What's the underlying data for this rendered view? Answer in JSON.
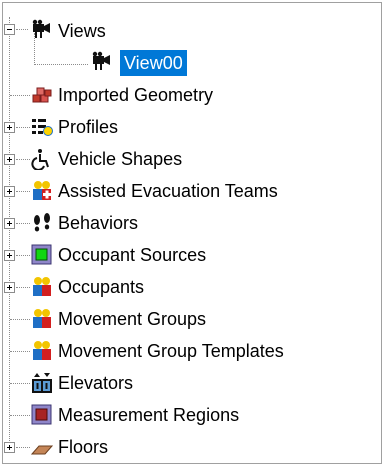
{
  "tree": {
    "views": {
      "label": "Views",
      "icon": "camera-icon"
    },
    "view00": {
      "label": "View00",
      "icon": "camera-icon"
    },
    "items": [
      {
        "label": "Imported Geometry",
        "icon": "geometry-blocks-icon"
      },
      {
        "label": "Profiles",
        "icon": "profiles-list-icon"
      },
      {
        "label": "Vehicle Shapes",
        "icon": "wheelchair-icon"
      },
      {
        "label": "Assisted Evacuation Teams",
        "icon": "team-icon"
      },
      {
        "label": "Behaviors",
        "icon": "footprints-icon"
      },
      {
        "label": "Occupant Sources",
        "icon": "occupant-source-icon"
      },
      {
        "label": "Occupants",
        "icon": "occupants-icon"
      },
      {
        "label": "Movement Groups",
        "icon": "movement-group-icon"
      },
      {
        "label": "Movement Group Templates",
        "icon": "movement-group-template-icon"
      },
      {
        "label": "Elevators",
        "icon": "elevator-icon"
      },
      {
        "label": "Measurement Regions",
        "icon": "measurement-region-icon"
      },
      {
        "label": "Floors",
        "icon": "floor-icon"
      }
    ]
  },
  "colors": {
    "selection": "#0078d7"
  }
}
